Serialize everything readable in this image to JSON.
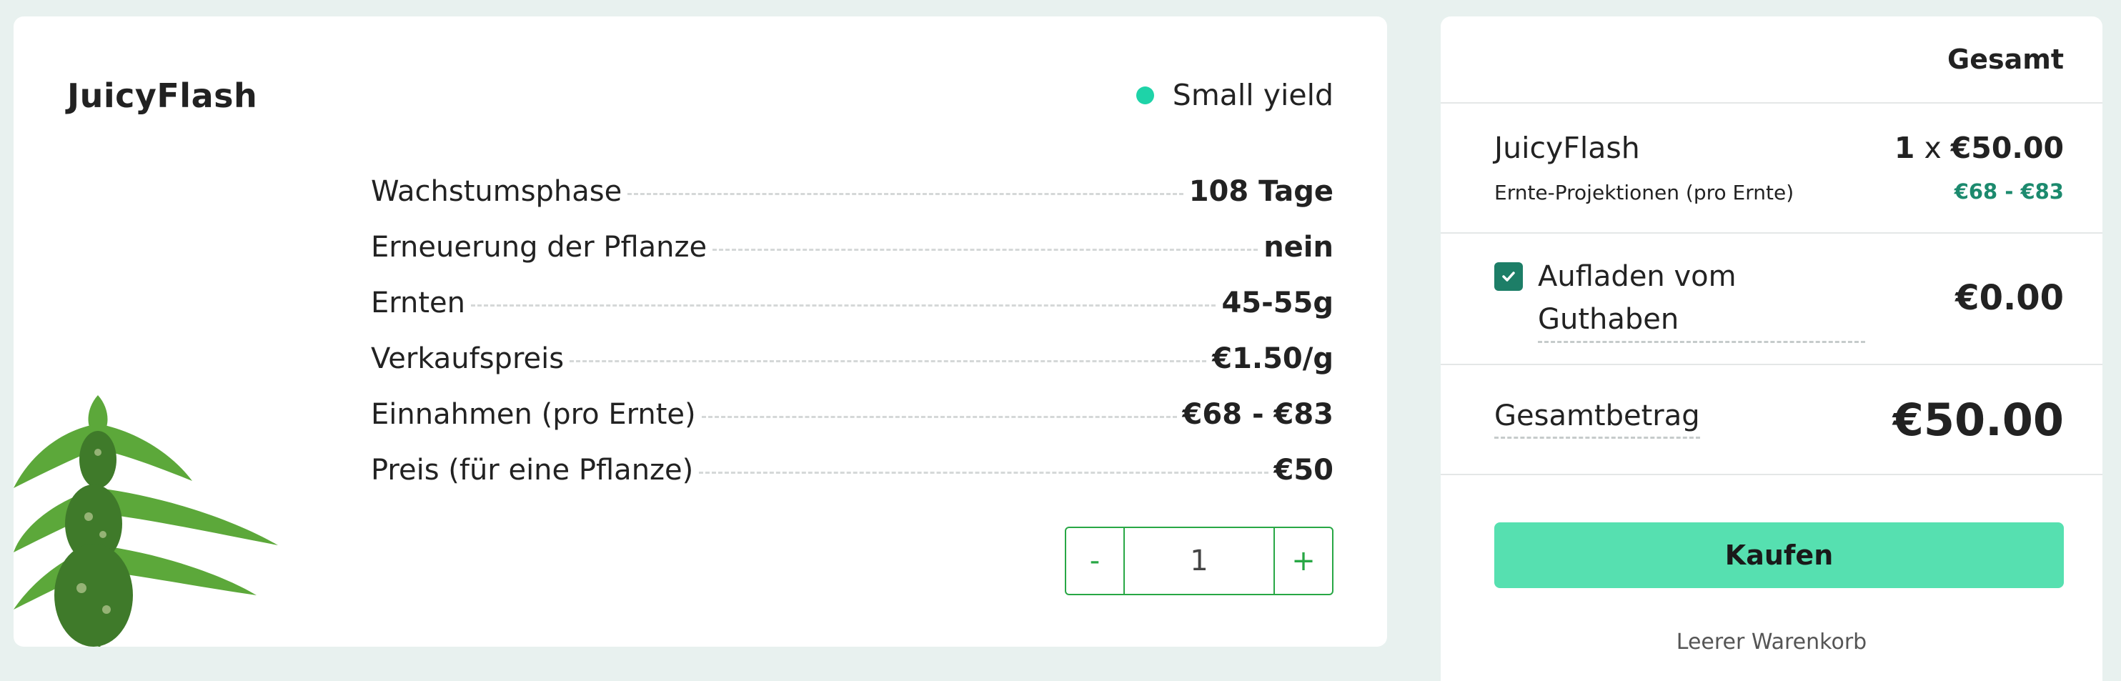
{
  "product": {
    "name": "JuicyFlash",
    "yield_label": "Small yield",
    "yield_color": "#1ed3a8",
    "specs": [
      {
        "label": "Wachstumsphase",
        "value": "108 Tage"
      },
      {
        "label": "Erneuerung der Pflanze",
        "value": "nein"
      },
      {
        "label": "Ernten",
        "value": "45-55g"
      },
      {
        "label": "Verkaufspreis",
        "value": "€1.50/g"
      },
      {
        "label": "Einnahmen (pro Ernte)",
        "value": "€68 - €83"
      },
      {
        "label": "Preis (für eine Pflanze)",
        "value": "€50"
      }
    ],
    "stepper": {
      "minus": "-",
      "quantity": "1",
      "plus": "+"
    }
  },
  "summary": {
    "header": "Gesamt",
    "item": {
      "name": "JuicyFlash",
      "qty": "1",
      "times": "x",
      "price": "€50.00",
      "projection_label": "Ernte-Projektionen (pro Ernte)",
      "projection_value": "€68 - €83"
    },
    "credit": {
      "checked": true,
      "label": "Aufladen vom Guthaben",
      "value": "€0.00"
    },
    "total": {
      "label": "Gesamtbetrag",
      "value": "€50.00"
    },
    "buy_label": "Kaufen",
    "clear_label": "Leerer Warenkorb"
  },
  "colors": {
    "accent": "#56e0b0",
    "stepper": "#28a745",
    "projection": "#1c8a6e",
    "checkbox": "#1d7e67"
  }
}
